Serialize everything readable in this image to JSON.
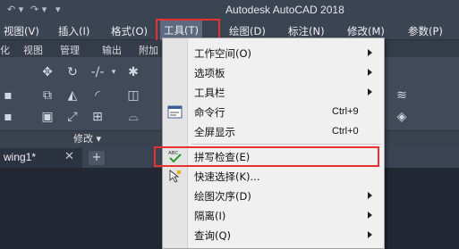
{
  "app": {
    "title": "Autodesk AutoCAD 2018"
  },
  "quick_access": {
    "icons": [
      "undo-icon",
      "redo-icon",
      "dropdown-icon"
    ]
  },
  "menubar": {
    "items": [
      {
        "label": "视图(V)"
      },
      {
        "label": "插入(I)"
      },
      {
        "label": "格式(O)"
      },
      {
        "label": "工具(T)"
      },
      {
        "label": "绘图(D)"
      },
      {
        "label": "标注(N)"
      },
      {
        "label": "修改(M)"
      },
      {
        "label": "参数(P)"
      }
    ],
    "active": "工具(T)"
  },
  "ribbon_tabs": [
    "化",
    "视图",
    "管理",
    "输出",
    "附加"
  ],
  "ribbon_panel": {
    "label": "修改 ▾"
  },
  "file_tabs": [
    {
      "label": "wing1*"
    }
  ],
  "dropdown": {
    "items": [
      {
        "label": "工作空间(O)",
        "submenu": true
      },
      {
        "label": "选项板",
        "submenu": true
      },
      {
        "label": "工具栏",
        "submenu": true
      },
      {
        "label": "命令行",
        "shortcut": "Ctrl+9",
        "icon": "command-line-icon"
      },
      {
        "label": "全屏显示",
        "shortcut": "Ctrl+0"
      },
      {
        "label": "拼写检查(E)",
        "icon": "spell-check-icon",
        "highlighted": true
      },
      {
        "label": "快速选择(K)...",
        "icon": "quick-select-icon"
      },
      {
        "label": "绘图次序(D)",
        "submenu": true
      },
      {
        "label": "隔离(I)",
        "submenu": true
      },
      {
        "label": "查询(Q)",
        "submenu": true
      }
    ]
  },
  "colors": {
    "highlight_box": "#e8302c",
    "menu_bg": "#3b4453",
    "dropdown_bg": "#f0f0f0"
  }
}
